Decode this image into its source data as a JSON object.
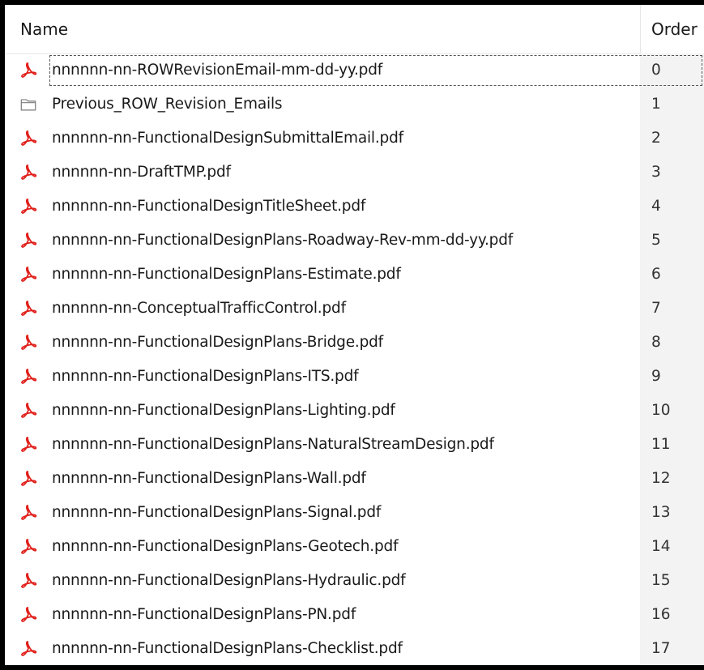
{
  "columns": {
    "name_label": "Name",
    "order_label": "Order"
  },
  "colors": {
    "pdf_icon": "#e0201b",
    "folder_icon": "#7a7a7a",
    "order_column_bg": "#f3f3f3"
  },
  "files": [
    {
      "name": "nnnnnn-nn-ROWRevisionEmail-mm-dd-yy.pdf",
      "order": "0",
      "icon": "pdf-icon",
      "focused": true
    },
    {
      "name": "Previous_ROW_Revision_Emails",
      "order": "1",
      "icon": "folder-icon"
    },
    {
      "name": "nnnnnn-nn-FunctionalDesignSubmittalEmail.pdf",
      "order": "2",
      "icon": "pdf-icon"
    },
    {
      "name": "nnnnnn-nn-DraftTMP.pdf",
      "order": "3",
      "icon": "pdf-icon"
    },
    {
      "name": "nnnnnn-nn-FunctionalDesignTitleSheet.pdf",
      "order": "4",
      "icon": "pdf-icon"
    },
    {
      "name": "nnnnnn-nn-FunctionalDesignPlans-Roadway-Rev-mm-dd-yy.pdf",
      "order": "5",
      "icon": "pdf-icon"
    },
    {
      "name": "nnnnnn-nn-FunctionalDesignPlans-Estimate.pdf",
      "order": "6",
      "icon": "pdf-icon"
    },
    {
      "name": "nnnnnn-nn-ConceptualTrafficControl.pdf",
      "order": "7",
      "icon": "pdf-icon"
    },
    {
      "name": "nnnnnn-nn-FunctionalDesignPlans-Bridge.pdf",
      "order": "8",
      "icon": "pdf-icon"
    },
    {
      "name": "nnnnnn-nn-FunctionalDesignPlans-ITS.pdf",
      "order": "9",
      "icon": "pdf-icon"
    },
    {
      "name": "nnnnnn-nn-FunctionalDesignPlans-Lighting.pdf",
      "order": "10",
      "icon": "pdf-icon"
    },
    {
      "name": "nnnnnn-nn-FunctionalDesignPlans-NaturalStreamDesign.pdf",
      "order": "11",
      "icon": "pdf-icon"
    },
    {
      "name": "nnnnnn-nn-FunctionalDesignPlans-Wall.pdf",
      "order": "12",
      "icon": "pdf-icon"
    },
    {
      "name": "nnnnnn-nn-FunctionalDesignPlans-Signal.pdf",
      "order": "13",
      "icon": "pdf-icon"
    },
    {
      "name": "nnnnnn-nn-FunctionalDesignPlans-Geotech.pdf",
      "order": "14",
      "icon": "pdf-icon"
    },
    {
      "name": "nnnnnn-nn-FunctionalDesignPlans-Hydraulic.pdf",
      "order": "15",
      "icon": "pdf-icon"
    },
    {
      "name": "nnnnnn-nn-FunctionalDesignPlans-PN.pdf",
      "order": "16",
      "icon": "pdf-icon"
    },
    {
      "name": "nnnnnn-nn-FunctionalDesignPlans-Checklist.pdf",
      "order": "17",
      "icon": "pdf-icon"
    }
  ]
}
